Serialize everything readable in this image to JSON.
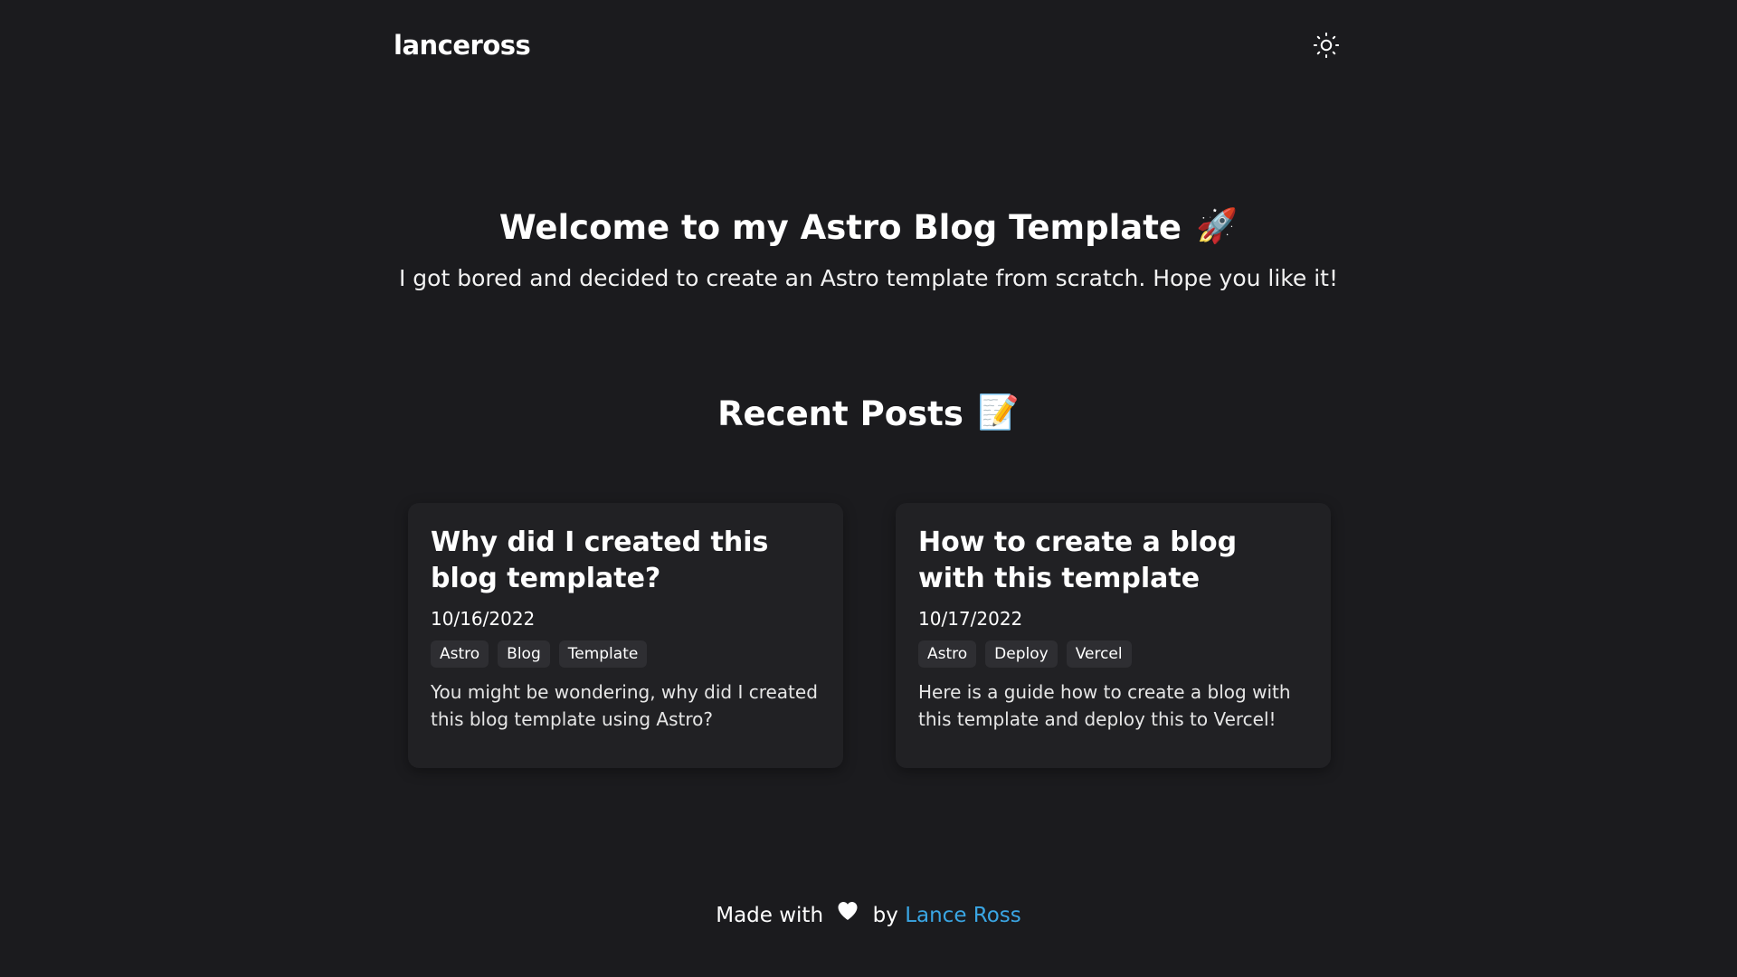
{
  "header": {
    "logo": "lanceross",
    "theme_toggle_icon": "sun-icon"
  },
  "hero": {
    "title": "Welcome to my Astro Blog Template",
    "title_emoji": "🚀",
    "subtitle": "I got bored and decided to create an Astro template from scratch. Hope you like it!"
  },
  "recent": {
    "heading": "Recent Posts",
    "heading_emoji": "📝"
  },
  "posts": [
    {
      "title": "Why did I created this blog template?",
      "date": "10/16/2022",
      "tags": [
        "Astro",
        "Blog",
        "Template"
      ],
      "description": "You might be wondering, why did I created this blog template using Astro?"
    },
    {
      "title": "How to create a blog with this template",
      "date": "10/17/2022",
      "tags": [
        "Astro",
        "Deploy",
        "Vercel"
      ],
      "description": "Here is a guide how to create a blog with this template and deploy this to Vercel!"
    }
  ],
  "footer": {
    "made_with": "Made with",
    "heart_icon": "heart-icon",
    "by": "by",
    "author_link": "Lance Ross"
  },
  "colors": {
    "background": "#1b1b1e",
    "card": "#212124",
    "tag": "#2e2e32",
    "link": "#3aa6e4"
  }
}
